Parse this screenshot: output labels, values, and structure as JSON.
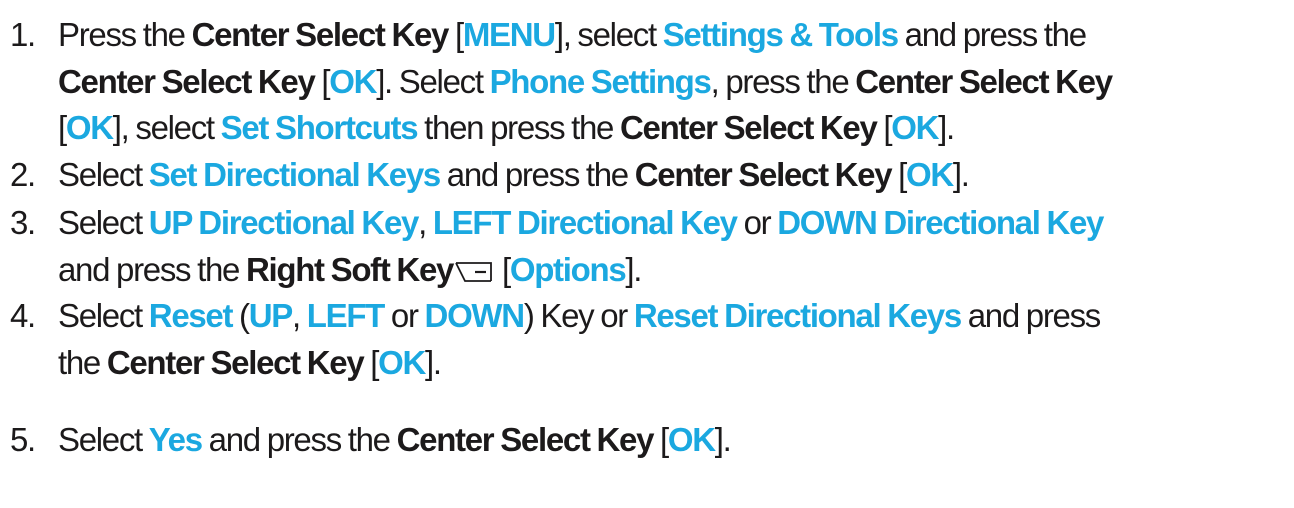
{
  "steps": [
    {
      "num": "1.",
      "lines": [
        [
          "Press the ",
          "Center Select Key",
          " [",
          "MENU",
          "], select ",
          "Settings & Tools",
          " and press the"
        ],
        [
          "Center Select Key",
          " [",
          "OK",
          "]. Select ",
          "Phone Settings",
          ", press the ",
          "Center Select Key"
        ],
        [
          "[",
          "OK",
          "], select ",
          "Set Shortcuts",
          " then press the ",
          "Center Select Key",
          " [",
          "OK",
          "]."
        ]
      ]
    },
    {
      "num": "2.",
      "lines": [
        [
          "Select ",
          "Set Directional Keys",
          " and press the ",
          "Center Select Key",
          " [",
          "OK",
          "]."
        ]
      ]
    },
    {
      "num": "3.",
      "lines": [
        [
          "Select ",
          "UP Directional Key",
          ", ",
          "LEFT Directional Key",
          " or ",
          "DOWN Directional Key"
        ],
        [
          "and press the ",
          "Right Soft Key",
          " [",
          "Options",
          "]."
        ]
      ]
    },
    {
      "num": "4.",
      "lines": [
        [
          "Select ",
          "Reset",
          " (",
          "UP",
          ", ",
          "LEFT",
          " or ",
          "DOWN",
          ") Key or ",
          "Reset Directional Keys",
          " and press"
        ],
        [
          "the ",
          "Center Select Key",
          " [",
          "OK",
          "]."
        ]
      ]
    },
    {
      "num": "5.",
      "lines": [
        [
          "Select ",
          "Yes",
          " and press the ",
          "Center Select Key",
          " [",
          "OK",
          "]."
        ]
      ]
    }
  ],
  "icons": {
    "right_soft_key": "right-soft-key-icon"
  },
  "colors": {
    "text": "#1c1a1b",
    "highlight": "#1ba8e0"
  }
}
